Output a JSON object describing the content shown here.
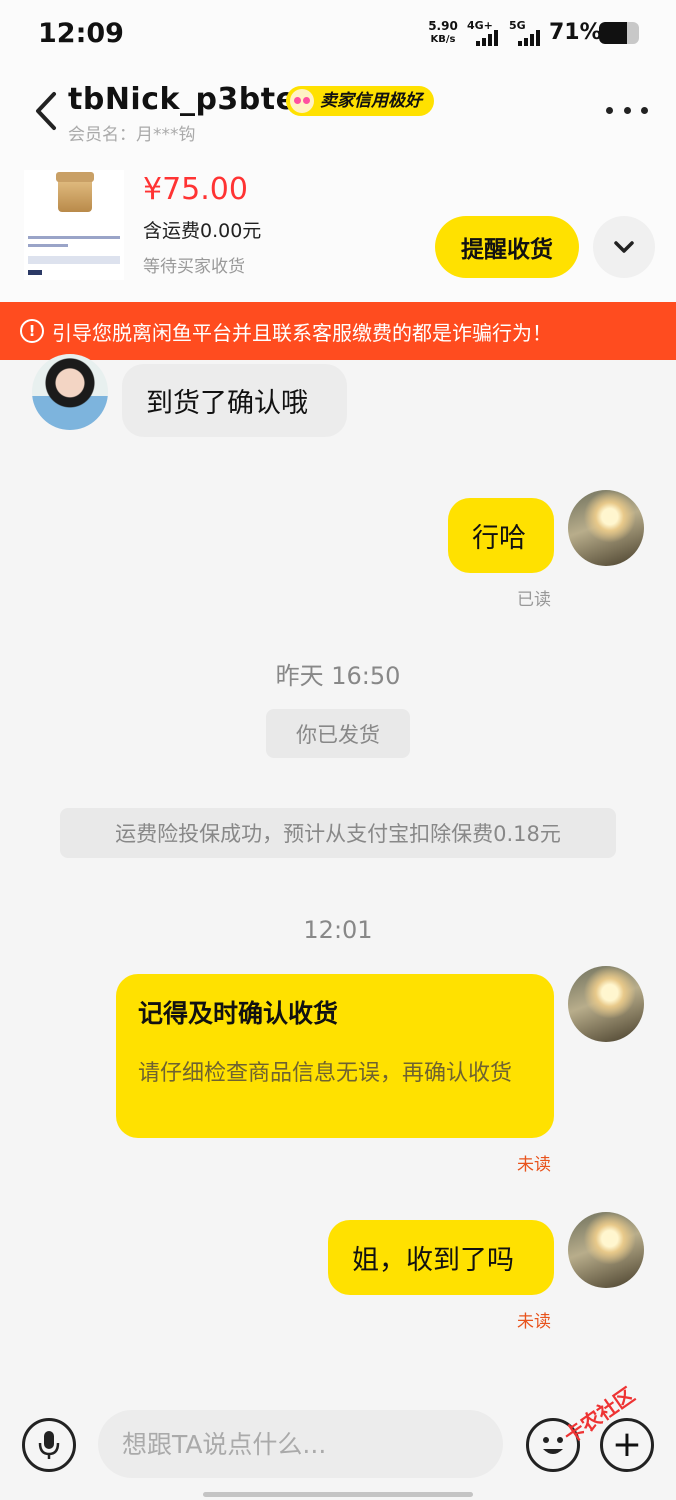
{
  "status_bar": {
    "time": "12:09",
    "net_speed_value": "5.90",
    "net_speed_unit": "KB/s",
    "signal1_label": "4G+",
    "signal2_label": "5G",
    "battery_percent": "71%",
    "battery_level": 0.71
  },
  "header": {
    "nickname": "tbNick_p3bte",
    "badge": "卖家信用极好",
    "member_name": "会员名：月***钩"
  },
  "product": {
    "price": "¥75.00",
    "shipping": "含运费0.00元",
    "status": "等待买家收货",
    "remind_button": "提醒收货"
  },
  "warning": {
    "icon": "!",
    "text": "引导您脱离闲鱼平台并且联系客服缴费的都是诈骗行为！"
  },
  "messages": {
    "buyer_msg1": "到货了确认哦",
    "seller_msg1": "行哈",
    "seller_msg1_status": "已读",
    "time1": "昨天 16:50",
    "system1": "你已发货",
    "system2": "运费险投保成功，预计从支付宝扣除保费0.18元",
    "time2": "12:01",
    "card_title": "记得及时确认收货",
    "card_body": "请仔细检查商品信息无误，再确认收货",
    "card_status": "未读",
    "seller_msg3": "姐，收到了吗",
    "seller_msg3_status": "未读"
  },
  "input": {
    "placeholder": "想跟TA说点什么..."
  },
  "watermark": "卡农社区",
  "colors": {
    "accent_yellow": "#ffe100",
    "price_red": "#ff3333",
    "warning_orange": "#ff4c1f",
    "unread_orange": "#e8531c"
  }
}
